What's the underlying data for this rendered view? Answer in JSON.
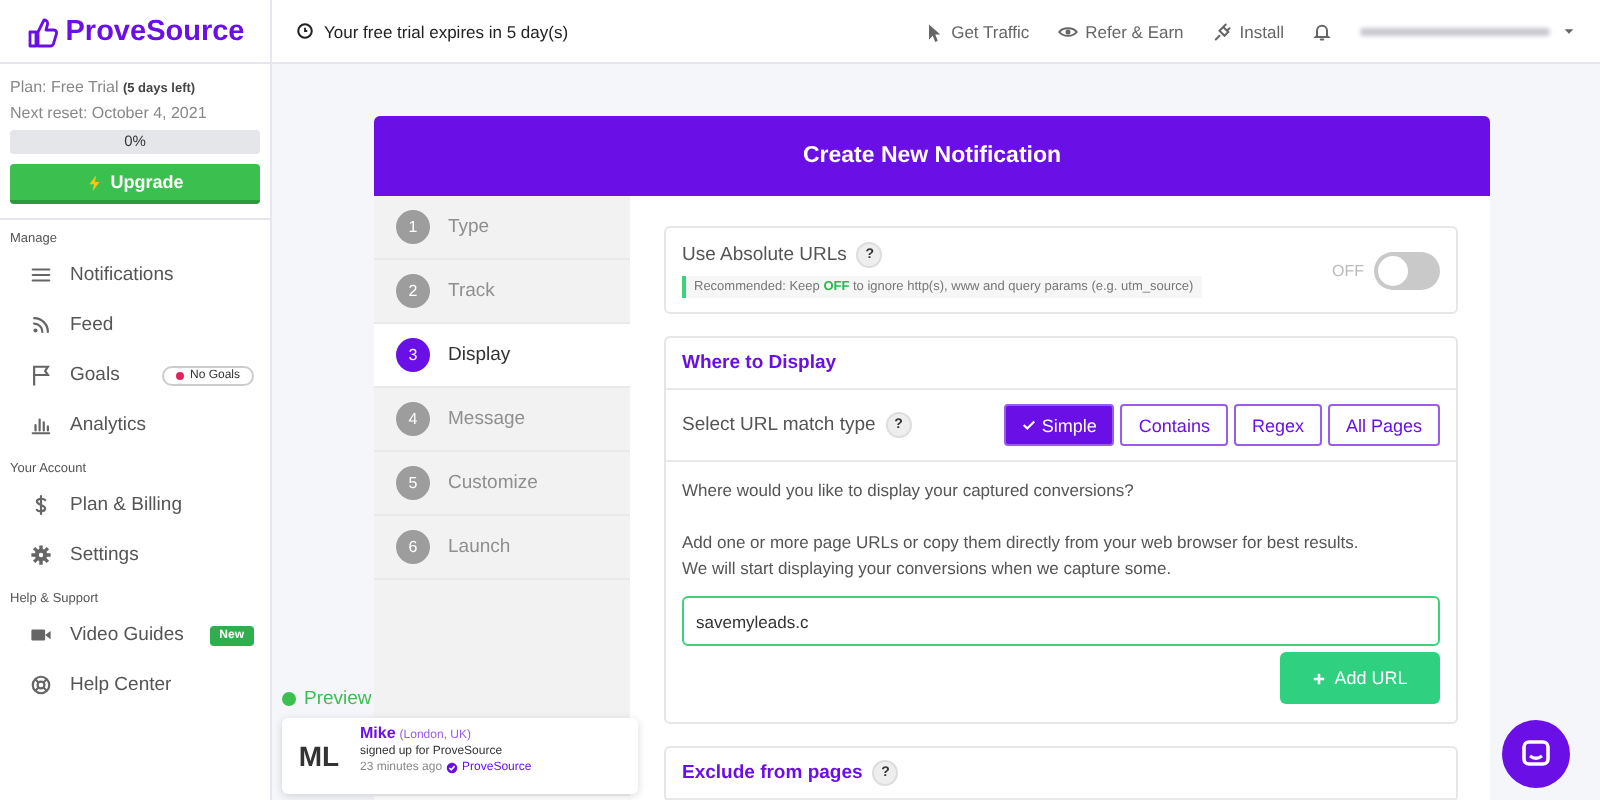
{
  "brand": {
    "name": "ProveSource"
  },
  "trial_notice": "Your free trial expires in 5 day(s)",
  "top_nav": [
    {
      "label": "Get Traffic"
    },
    {
      "label": "Refer & Earn"
    },
    {
      "label": "Install"
    }
  ],
  "plan": {
    "plan_line": "Plan: Free Trial **(5 days left)**",
    "reset": "Next reset: October 4, 2021",
    "usage": {
      "level": 0,
      "reading": "0%"
    },
    "upgrade": "Upgrade"
  },
  "sidebar": {
    "sections": [
      {
        "title": "Manage",
        "items": [
          {
            "label": "Notifications"
          },
          {
            "label": "Feed"
          },
          {
            "label": "Goals",
            "badge": {
              "kind": "status",
              "text": "No Goals",
              "color": "#e0245e"
            }
          },
          {
            "label": "Analytics"
          }
        ]
      },
      {
        "title": "Your Account",
        "items": [
          {
            "label": "Plan & Billing"
          },
          {
            "label": "Settings"
          }
        ]
      },
      {
        "title": "Help & Support",
        "items": [
          {
            "label": "Video Guides",
            "badge": {
              "kind": "new",
              "text": "New"
            }
          },
          {
            "label": "Help Center"
          }
        ]
      }
    ]
  },
  "card": {
    "title": "Create New Notification",
    "steps": [
      {
        "number": "1",
        "label": "Type",
        "selected": false
      },
      {
        "number": "2",
        "label": "Track",
        "selected": false
      },
      {
        "number": "3",
        "label": "Display",
        "selected": true
      },
      {
        "number": "4",
        "label": "Message",
        "selected": false
      },
      {
        "number": "5",
        "label": "Customize",
        "selected": false
      },
      {
        "number": "6",
        "label": "Launch",
        "selected": false
      }
    ],
    "absolute_urls": {
      "label": "Use Absolute URLs",
      "help": "?",
      "hint": "Recommended: Keep **OFF** to ignore http(s), www and query params (e.g. utm_source)",
      "toggle_label": "OFF",
      "on": false
    },
    "where_to_display": {
      "title": "Where to Display",
      "match_label": "Select URL match type",
      "help": "?",
      "match_types": [
        {
          "label": "Simple",
          "selected": true
        },
        {
          "label": "Contains",
          "selected": false
        },
        {
          "label": "Regex",
          "selected": false
        },
        {
          "label": "All Pages",
          "selected": false
        }
      ],
      "question": "Where would you like to display your captured conversions?",
      "instructions": [
        "Add one or more page URLs or copy them directly from your web browser for best results.",
        "We will start displaying your conversions when we capture some."
      ],
      "url_value": "savemyleads.c",
      "add_button": "Add URL"
    },
    "exclude": {
      "title": "Exclude from pages",
      "help": "?"
    }
  },
  "preview": {
    "label": "Preview",
    "initials": "ML",
    "name": "Mike",
    "location": "(London, UK)",
    "action": "signed up for ProveSource",
    "time": "23 minutes ago",
    "verified_by": "ProveSource"
  }
}
